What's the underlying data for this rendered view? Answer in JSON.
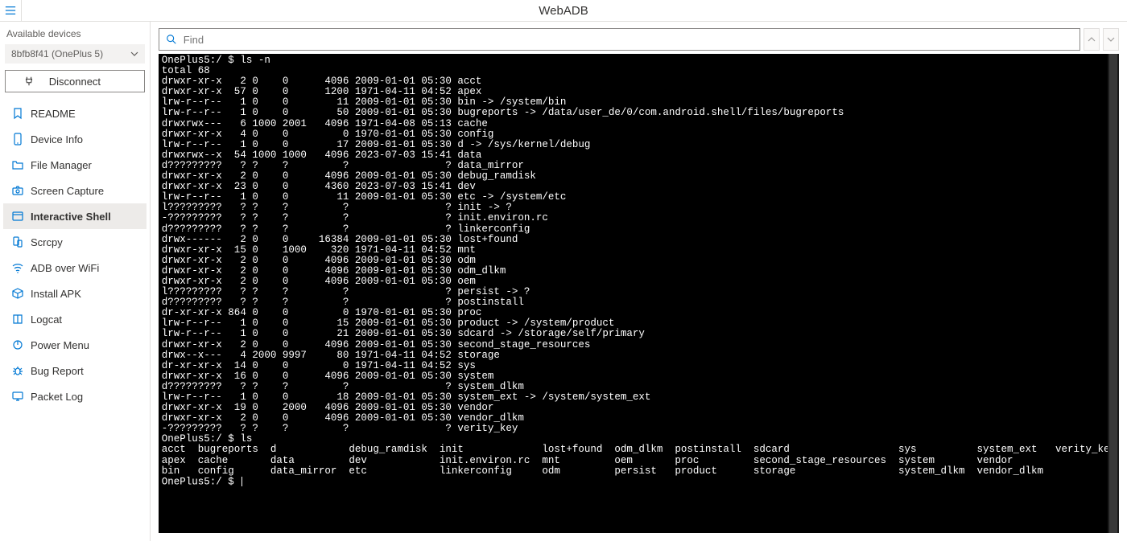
{
  "app": {
    "title": "WebADB"
  },
  "sidebar": {
    "available_label": "Available devices",
    "selected_device": "8bfb8f41 (OnePlus 5)",
    "disconnect_label": "Disconnect",
    "items": [
      {
        "label": "README",
        "icon": "bookmark-icon"
      },
      {
        "label": "Device Info",
        "icon": "phone-icon"
      },
      {
        "label": "File Manager",
        "icon": "folder-icon"
      },
      {
        "label": "Screen Capture",
        "icon": "camera-icon"
      },
      {
        "label": "Interactive Shell",
        "icon": "window-icon",
        "active": true
      },
      {
        "label": "Scrcpy",
        "icon": "phone-link-icon"
      },
      {
        "label": "ADB over WiFi",
        "icon": "wifi-icon"
      },
      {
        "label": "Install APK",
        "icon": "box-icon"
      },
      {
        "label": "Logcat",
        "icon": "book-icon"
      },
      {
        "label": "Power Menu",
        "icon": "power-icon"
      },
      {
        "label": "Bug Report",
        "icon": "bug-icon"
      },
      {
        "label": "Packet Log",
        "icon": "monitor-icon"
      }
    ]
  },
  "findbar": {
    "placeholder": "Find"
  },
  "terminal": {
    "lines": [
      "OnePlus5:/ $ ls -n",
      "total 68",
      "drwxr-xr-x   2 0    0      4096 2009-01-01 05:30 acct",
      "drwxr-xr-x  57 0    0      1200 1971-04-11 04:52 apex",
      "lrw-r--r--   1 0    0        11 2009-01-01 05:30 bin -> /system/bin",
      "lrw-r--r--   1 0    0        50 2009-01-01 05:30 bugreports -> /data/user_de/0/com.android.shell/files/bugreports",
      "drwxrwx---   6 1000 2001   4096 1971-04-08 05:13 cache",
      "drwxr-xr-x   4 0    0         0 1970-01-01 05:30 config",
      "lrw-r--r--   1 0    0        17 2009-01-01 05:30 d -> /sys/kernel/debug",
      "drwxrwx--x  54 1000 1000   4096 2023-07-03 15:41 data",
      "d?????????   ? ?    ?         ?                ? data_mirror",
      "drwxr-xr-x   2 0    0      4096 2009-01-01 05:30 debug_ramdisk",
      "drwxr-xr-x  23 0    0      4360 2023-07-03 15:41 dev",
      "lrw-r--r--   1 0    0        11 2009-01-01 05:30 etc -> /system/etc",
      "l?????????   ? ?    ?         ?                ? init -> ?",
      "-?????????   ? ?    ?         ?                ? init.environ.rc",
      "d?????????   ? ?    ?         ?                ? linkerconfig",
      "drwx------   2 0    0     16384 2009-01-01 05:30 lost+found",
      "drwxr-xr-x  15 0    1000    320 1971-04-11 04:52 mnt",
      "drwxr-xr-x   2 0    0      4096 2009-01-01 05:30 odm",
      "drwxr-xr-x   2 0    0      4096 2009-01-01 05:30 odm_dlkm",
      "drwxr-xr-x   2 0    0      4096 2009-01-01 05:30 oem",
      "l?????????   ? ?    ?         ?                ? persist -> ?",
      "d?????????   ? ?    ?         ?                ? postinstall",
      "dr-xr-xr-x 864 0    0         0 1970-01-01 05:30 proc",
      "lrw-r--r--   1 0    0        15 2009-01-01 05:30 product -> /system/product",
      "lrw-r--r--   1 0    0        21 2009-01-01 05:30 sdcard -> /storage/self/primary",
      "drwxr-xr-x   2 0    0      4096 2009-01-01 05:30 second_stage_resources",
      "drwx--x---   4 2000 9997     80 1971-04-11 04:52 storage",
      "dr-xr-xr-x  14 0    0         0 1971-04-11 04:52 sys",
      "drwxr-xr-x  16 0    0      4096 2009-01-01 05:30 system",
      "d?????????   ? ?    ?         ?                ? system_dlkm",
      "lrw-r--r--   1 0    0        18 2009-01-01 05:30 system_ext -> /system/system_ext",
      "drwxr-xr-x  19 0    2000   4096 2009-01-01 05:30 vendor",
      "drwxr-xr-x   2 0    0      4096 2009-01-01 05:30 vendor_dlkm",
      "-?????????   ? ?    ?         ?                ? verity_key",
      "OnePlus5:/ $ ls",
      "acct  bugreports  d            debug_ramdisk  init             lost+found  odm_dlkm  postinstall  sdcard                  sys          system_ext   verity_key",
      "apex  cache       data         dev            init.environ.rc  mnt         oem       proc         second_stage_resources  system       vendor",
      "bin   config      data_mirror  etc            linkerconfig     odm         persist   product      storage                 system_dlkm  vendor_dlkm",
      "OnePlus5:/ $ "
    ]
  }
}
